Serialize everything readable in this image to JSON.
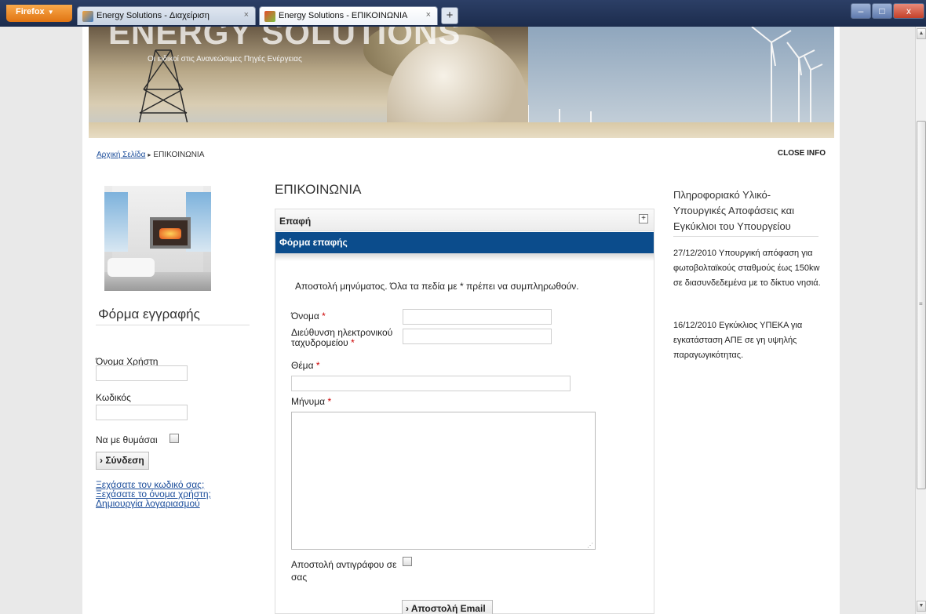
{
  "browser": {
    "menu_label": "Firefox",
    "tabs": [
      {
        "title": "Energy Solutions - Διαχείριση",
        "close": "×"
      },
      {
        "title": "Energy Solutions - ΕΠΙΚΟΙΝΩΝΙΑ",
        "close": "×"
      }
    ],
    "new_tab": "+",
    "window_controls": {
      "minimize": "–",
      "maximize": "□",
      "close": "x"
    }
  },
  "site": {
    "name": "ENERGY SOLUTIONS",
    "tagline": "Οι ειδικοί στις Ανανεώσιμες Πηγές Ενέργειας"
  },
  "breadcrumb": {
    "home": "Αρχική Σελίδα",
    "separator": "▸",
    "current": "ΕΠΙΚΟΙΝΩΝΙΑ"
  },
  "close_info": "CLOSE INFO",
  "login": {
    "title": "Φόρμα εγγραφής",
    "username_label": "Όνομα Χρήστη",
    "username_value": "",
    "password_label": "Κωδικός",
    "password_value": "",
    "remember_label": "Να με θυμάσαι",
    "remember_checked": false,
    "submit": "› Σύνδεση",
    "links": [
      "Ξεχάσατε τον κωδικό σας;",
      "Ξεχάσατε το όνομα χρήστη;",
      "Δημιουργία λογαριασμού"
    ]
  },
  "contact": {
    "title": "ΕΠΙΚΟΙΝΩΝΙΑ",
    "section_label": "Επαφή",
    "expand_icon": "+",
    "form_header": "Φόρμα επαφής",
    "instructions": "Αποστολή μηνύματος. Όλα τα πεδία με * πρέπει να συμπληρωθούν.",
    "required_mark": "*",
    "fields": {
      "name_label": "Όνομα",
      "email_label_line1": "Διεύθυνση ηλεκτρονικού",
      "email_label_line2": "ταχυδρομείου",
      "subject_label": "Θέμα",
      "message_label": "Μήνυμα"
    },
    "copy_label_line1": "Αποστολή αντιγράφου σε",
    "copy_label_line2": "σας",
    "copy_checked": false,
    "submit": "› Αποστολή Email"
  },
  "info": {
    "title": "Πληροφοριακό Υλικό-Υπουργικές Αποφάσεις και Εγκύκλιοι του Υπουργείου",
    "items": [
      "27/12/2010 Υπουργική απόφαση για φωτοβολταϊκούς σταθμούς έως 150kw σε διασυνδεδεμένα με το δίκτυο νησιά.",
      "16/12/2010 Εγκύκλιος ΥΠΕΚΑ για εγκατάσταση ΑΠΕ σε γη υψηλής παραγωγικότητας."
    ]
  },
  "colors": {
    "header_bar": "#0b4c8c",
    "link": "#1a4c9a",
    "required": "#cc0000"
  }
}
